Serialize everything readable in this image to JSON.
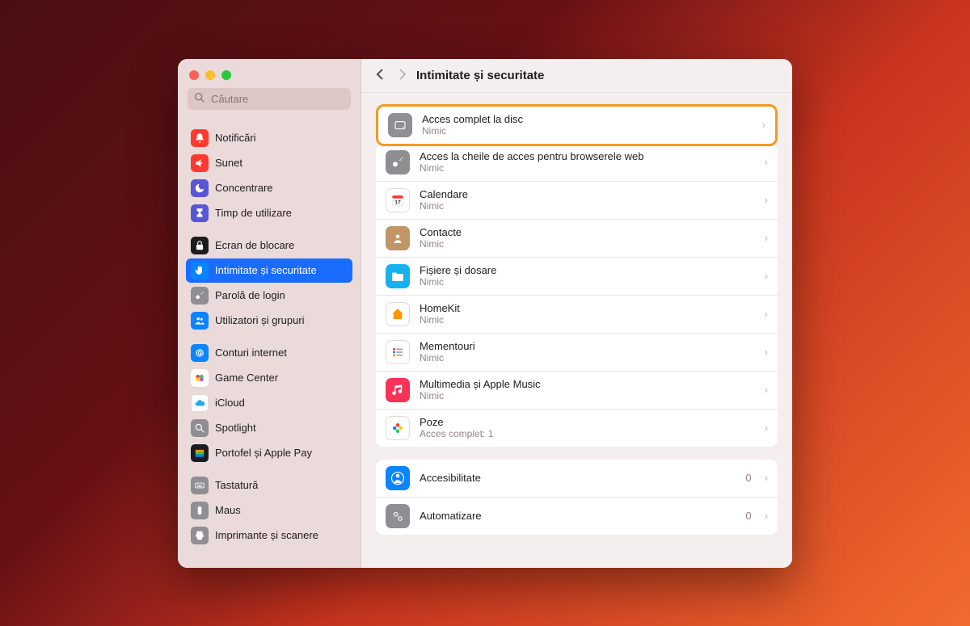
{
  "search": {
    "placeholder": "Căutare"
  },
  "header": {
    "title": "Intimitate și securitate"
  },
  "sidebar": {
    "groups": [
      {
        "items": [
          {
            "label": "Notificări",
            "bg": "#ff3b30",
            "icon": "bell"
          },
          {
            "label": "Sunet",
            "bg": "#ff3b30",
            "icon": "speaker"
          },
          {
            "label": "Concentrare",
            "bg": "#5856d6",
            "icon": "moon"
          },
          {
            "label": "Timp de utilizare",
            "bg": "#5856d6",
            "icon": "hourglass"
          }
        ]
      },
      {
        "items": [
          {
            "label": "Ecran de blocare",
            "bg": "#1d1d1f",
            "icon": "lock"
          },
          {
            "label": "Intimitate și securitate",
            "bg": "#0a84ff",
            "icon": "hand",
            "selected": true
          },
          {
            "label": "Parolă de login",
            "bg": "#8e8e93",
            "icon": "key"
          },
          {
            "label": "Utilizatori și grupuri",
            "bg": "#0a84ff",
            "icon": "people"
          }
        ]
      },
      {
        "items": [
          {
            "label": "Conturi internet",
            "bg": "#0a84ff",
            "icon": "at"
          },
          {
            "label": "Game Center",
            "bg": "grad-gc",
            "icon": "gc"
          },
          {
            "label": "iCloud",
            "bg": "#ffffff",
            "icon": "cloud"
          },
          {
            "label": "Spotlight",
            "bg": "#8e8e93",
            "icon": "search"
          },
          {
            "label": "Portofel și Apple Pay",
            "bg": "#1d1d1f",
            "icon": "wallet"
          }
        ]
      },
      {
        "items": [
          {
            "label": "Tastatură",
            "bg": "#8e8e93",
            "icon": "keyboard"
          },
          {
            "label": "Maus",
            "bg": "#8e8e93",
            "icon": "mouse"
          },
          {
            "label": "Imprimante și scanere",
            "bg": "#8e8e93",
            "icon": "printer"
          }
        ]
      }
    ]
  },
  "main": {
    "highlight": {
      "title": "Acces complet la disc",
      "sub": "Nimic",
      "bg": "#8e8e93",
      "icon": "disk"
    },
    "group1": [
      {
        "title": "Acces la cheile de acces pentru browserele web",
        "sub": "Nimic",
        "bg": "#8e8e93",
        "icon": "key"
      },
      {
        "title": "Calendare",
        "sub": "Nimic",
        "bg": "#ffffff",
        "icon": "calendar"
      },
      {
        "title": "Contacte",
        "sub": "Nimic",
        "bg": "#c19566",
        "icon": "contacts"
      },
      {
        "title": "Fișiere și dosare",
        "sub": "Nimic",
        "bg": "#17b1ee",
        "icon": "folder"
      },
      {
        "title": "HomeKit",
        "sub": "Nimic",
        "bg": "#ffffff",
        "icon": "home"
      },
      {
        "title": "Mementouri",
        "sub": "Nimic",
        "bg": "#ffffff",
        "icon": "reminders"
      },
      {
        "title": "Multimedia și Apple Music",
        "sub": "Nimic",
        "bg": "#fc3158",
        "icon": "music"
      },
      {
        "title": "Poze",
        "sub": "Acces complet: 1",
        "bg": "#ffffff",
        "icon": "photos"
      }
    ],
    "group2": [
      {
        "title": "Accesibilitate",
        "count": "0",
        "bg": "#0a84ff",
        "icon": "person"
      },
      {
        "title": "Automatizare",
        "count": "0",
        "bg": "#8e8e93",
        "icon": "gears"
      }
    ]
  }
}
